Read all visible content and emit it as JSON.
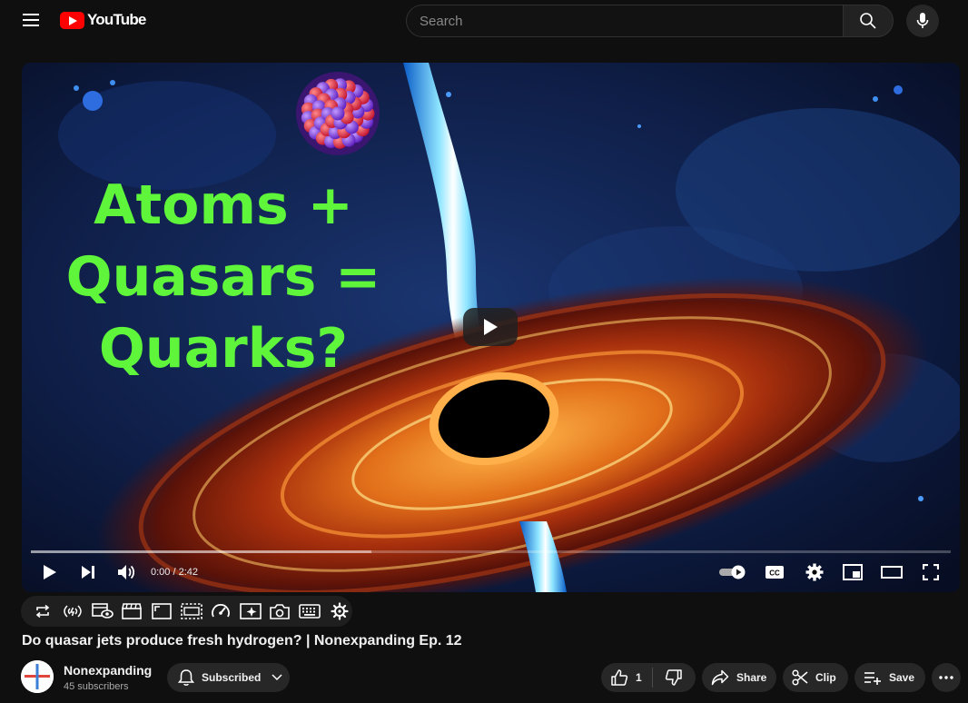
{
  "masthead": {
    "logo_text": "YouTube",
    "search_placeholder": "Search"
  },
  "player": {
    "thumbnail_title_lines": [
      "Atoms +",
      "Quasars =",
      "Quarks?"
    ],
    "time_display": "0:00 / 2:42",
    "buffered_fraction": 0.37
  },
  "video": {
    "title": "Do quasar jets produce fresh hydrogen? | Nonexpanding Ep. 12"
  },
  "channel": {
    "name": "Nonexpanding",
    "subscribers": "45 subscribers",
    "subscribe_label": "Subscribed"
  },
  "actions": {
    "like_count": "1",
    "share_label": "Share",
    "clip_label": "Clip",
    "save_label": "Save"
  },
  "colors": {
    "brand_red": "#ff0000",
    "thumbnail_text": "#5ef53a",
    "background": "#0f0f0f"
  }
}
